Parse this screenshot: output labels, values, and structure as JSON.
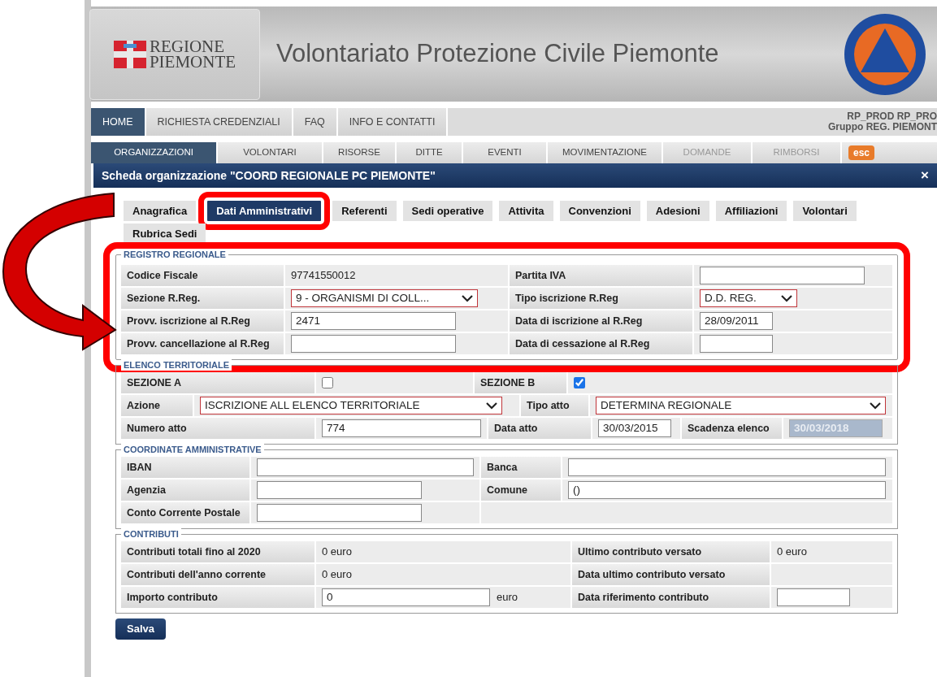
{
  "header": {
    "logo_text": [
      "REGIONE",
      "PIEMONTE"
    ],
    "title": "Volontariato Protezione Civile Piemonte"
  },
  "top_nav": {
    "items": [
      {
        "label": "HOME",
        "selected": true
      },
      {
        "label": "RICHIESTA CREDENZIALI",
        "selected": false
      },
      {
        "label": "FAQ",
        "selected": false
      },
      {
        "label": "INFO E CONTATTI",
        "selected": false
      }
    ],
    "user_info": [
      "RP_PROD RP_PRO",
      "Gruppo REG. PIEMONT"
    ]
  },
  "main_nav": {
    "items": [
      {
        "label": "ORGANIZZAZIONI",
        "selected": true,
        "disabled": false
      },
      {
        "label": "VOLONTARI",
        "selected": false,
        "disabled": false
      },
      {
        "label": "RISORSE",
        "selected": false,
        "disabled": false
      },
      {
        "label": "DITTE",
        "selected": false,
        "disabled": false
      },
      {
        "label": "EVENTI",
        "selected": false,
        "disabled": false
      },
      {
        "label": "MOVIMENTAZIONE",
        "selected": false,
        "disabled": false
      },
      {
        "label": "DOMANDE",
        "selected": false,
        "disabled": true
      },
      {
        "label": "RIMBORSI",
        "selected": false,
        "disabled": true
      }
    ],
    "exit_button": "esc"
  },
  "dialog": {
    "title": "Scheda organizzazione \"COORD REGIONALE PC PIEMONTE\"",
    "close": "×"
  },
  "tabs": [
    {
      "label": "Anagrafica",
      "selected": false
    },
    {
      "label": "Dati Amministrativi",
      "selected": true
    },
    {
      "label": "Referenti",
      "selected": false
    },
    {
      "label": "Sedi operative",
      "selected": false
    },
    {
      "label": "Attivita",
      "selected": false
    },
    {
      "label": "Convenzioni",
      "selected": false
    },
    {
      "label": "Adesioni",
      "selected": false
    },
    {
      "label": "Affiliazioni",
      "selected": false
    },
    {
      "label": "Volontari",
      "selected": false
    },
    {
      "label": "Rubrica Sedi",
      "selected": false
    }
  ],
  "sections": [
    {
      "title": "REGISTRO REGIONALE",
      "rows": [
        [
          {
            "kind": "label",
            "text": "Codice Fiscale"
          },
          {
            "kind": "text",
            "text": "97741550012"
          },
          {
            "kind": "label",
            "text": "Partita IVA"
          },
          {
            "kind": "input"
          }
        ],
        [
          {
            "kind": "label",
            "text": "Sezione R.Reg."
          },
          {
            "kind": "select",
            "value": "9 - ORGANISMI DI COLL..."
          },
          {
            "kind": "label",
            "text": "Tipo iscrizione R.Reg"
          },
          {
            "kind": "select",
            "value": "D.D. REG."
          }
        ],
        [
          {
            "kind": "label",
            "text": "Provv. iscrizione al R.Reg"
          },
          {
            "kind": "input",
            "value": "2471"
          },
          {
            "kind": "label",
            "text": "Data di iscrizione al R.Reg"
          },
          {
            "kind": "input",
            "value": "28/09/2011"
          }
        ],
        [
          {
            "kind": "label",
            "text": "Provv. cancellazione al R.Reg"
          },
          {
            "kind": "input"
          },
          {
            "kind": "label",
            "text": "Data di cessazione al R.Reg"
          },
          {
            "kind": "input"
          }
        ]
      ]
    },
    {
      "title": "ELENCO TERRITORIALE",
      "rows": [
        [
          {
            "kind": "label",
            "text": "SEZIONE A"
          },
          {
            "kind": "check",
            "checked": false
          },
          {
            "kind": "label",
            "text": "SEZIONE B"
          },
          {
            "kind": "check",
            "checked": true
          }
        ],
        [
          {
            "kind": "label",
            "text": "Azione"
          },
          {
            "kind": "select",
            "value": "ISCRIZIONE ALL ELENCO TERRITORIALE"
          },
          {
            "kind": "label",
            "text": "Tipo atto"
          },
          {
            "kind": "select",
            "value": "DETERMINA REGIONALE"
          }
        ],
        [
          {
            "kind": "label",
            "text": "Numero atto"
          },
          {
            "kind": "input",
            "value": "774"
          },
          {
            "kind": "label",
            "text": "Data atto"
          },
          {
            "kind": "input",
            "value": "30/03/2015"
          },
          {
            "kind": "label",
            "text": "Scadenza elenco"
          },
          {
            "kind": "readonly",
            "value": "30/03/2018"
          }
        ]
      ]
    },
    {
      "title": "COORDINATE AMMINISTRATIVE",
      "rows": [
        [
          {
            "kind": "label",
            "text": "IBAN"
          },
          {
            "kind": "input"
          },
          {
            "kind": "label",
            "text": "Banca"
          },
          {
            "kind": "input"
          }
        ],
        [
          {
            "kind": "label",
            "text": "Agenzia"
          },
          {
            "kind": "input"
          },
          {
            "kind": "label",
            "text": "Comune"
          },
          {
            "kind": "input",
            "value": "()"
          }
        ],
        [
          {
            "kind": "label",
            "text": "Conto Corrente Postale"
          },
          {
            "kind": "input"
          },
          {
            "kind": "empty"
          }
        ]
      ]
    },
    {
      "title": "CONTRIBUTI",
      "rows": [
        [
          {
            "kind": "label",
            "text": "Contributi totali fino al 2020"
          },
          {
            "kind": "text",
            "text": "0 euro"
          },
          {
            "kind": "label",
            "text": "Ultimo contributo versato"
          },
          {
            "kind": "text",
            "text": "0 euro"
          }
        ],
        [
          {
            "kind": "label",
            "text": "Contributi dell'anno corrente"
          },
          {
            "kind": "text",
            "text": "0 euro"
          },
          {
            "kind": "label",
            "text": "Data ultimo contributo versato"
          },
          {
            "kind": "empty"
          }
        ],
        [
          {
            "kind": "label",
            "text": "Importo contributo"
          },
          {
            "kind": "input",
            "value": "0",
            "suffix": "euro"
          },
          {
            "kind": "label",
            "text": "Data riferimento contributo"
          },
          {
            "kind": "input"
          }
        ]
      ]
    }
  ],
  "save_button": "Salva"
}
